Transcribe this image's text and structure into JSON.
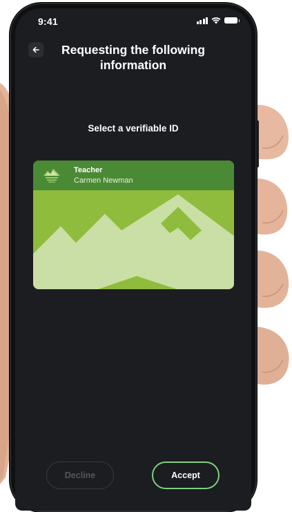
{
  "status_bar": {
    "time": "9:41",
    "icons": [
      "signal-icon",
      "wifi-icon",
      "battery-icon"
    ]
  },
  "header": {
    "back_icon": "arrow-left-icon",
    "title": "Requesting the following information"
  },
  "prompt": "Select a verifiable ID",
  "id_card": {
    "logo_icon": "mountain-logo-icon",
    "title": "Teacher",
    "holder_name": "Carmen Newman",
    "colors": {
      "header": "#4a8a35",
      "background": "#8fbc3c",
      "mountains": "#c9dfa6"
    }
  },
  "actions": {
    "decline_label": "Decline",
    "accept_label": "Accept"
  },
  "colors": {
    "screen_background": "#1c1d21",
    "accept_border": "#7ed184",
    "decline_text": "#55565a"
  }
}
